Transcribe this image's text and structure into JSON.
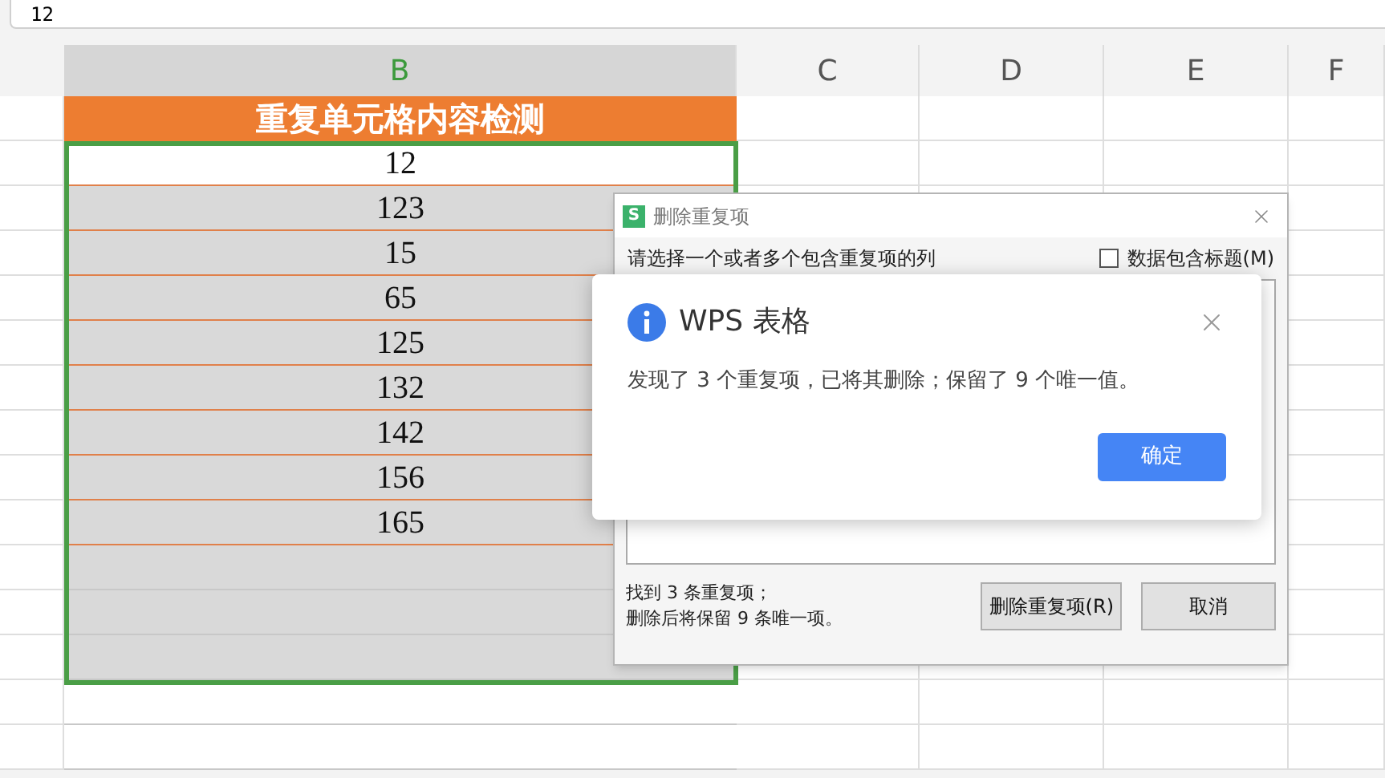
{
  "formula_bar": {
    "value": "12"
  },
  "columns": [
    {
      "label": "B",
      "selected": true
    },
    {
      "label": "C",
      "selected": false
    },
    {
      "label": "D",
      "selected": false
    },
    {
      "label": "E",
      "selected": false
    },
    {
      "label": "F",
      "selected": false
    }
  ],
  "sheet": {
    "header": "重复单元格内容检测",
    "cells": [
      "12",
      "123",
      "15",
      "65",
      "125",
      "132",
      "142",
      "156",
      "165"
    ]
  },
  "remove_dialog": {
    "app_icon": "S",
    "title": "删除重复项",
    "instruction": "请选择一个或者多个包含重复项的列",
    "header_checkbox": {
      "label": "数据包含标题(M)",
      "checked": false
    },
    "summary": [
      "找到 3 条重复项；",
      "删除后将保留 9 条唯一项。"
    ],
    "buttons": [
      "删除重复项(R)",
      "取消"
    ]
  },
  "alert": {
    "title": "WPS 表格",
    "message": "发现了 3 个重复项，已将其删除；保留了 9 个唯一值。",
    "button": "确定"
  }
}
